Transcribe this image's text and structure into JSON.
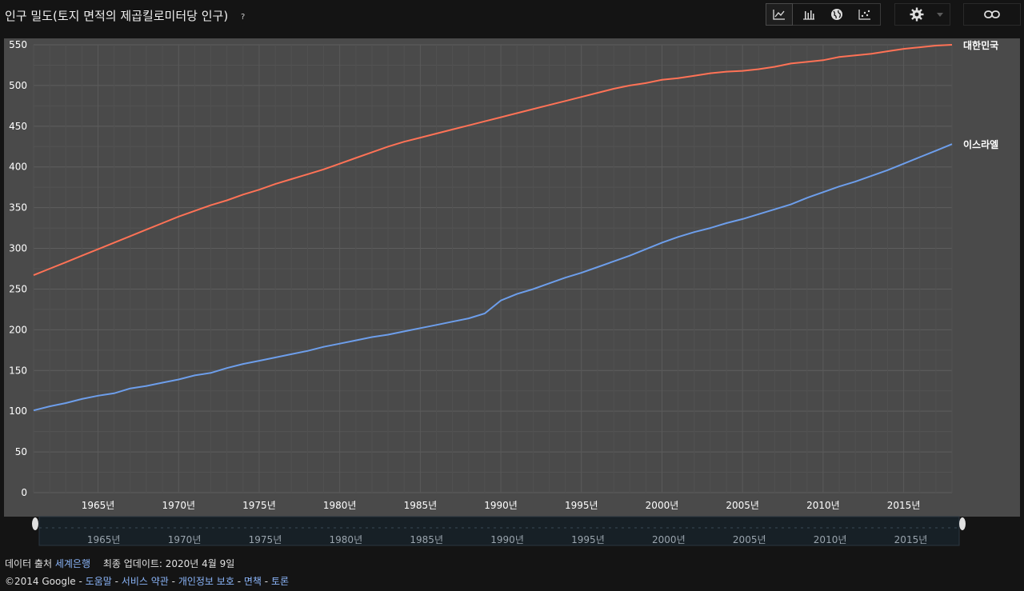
{
  "header": {
    "title": "인구 밀도(토지 면적의 제곱킬로미터당 인구)",
    "help": "?"
  },
  "toolbar": {
    "buttons": [
      "line-chart-icon",
      "bar-chart-icon",
      "globe-icon",
      "scatter-icon"
    ],
    "settings_icon": "gear-icon",
    "dropdown_icon": "caret-down-icon",
    "link_icon": "link-icon"
  },
  "chart_data": {
    "type": "line",
    "title": "",
    "xlabel": "",
    "ylabel": "",
    "xlim": [
      1961,
      2018
    ],
    "ylim": [
      0,
      550
    ],
    "yticks": [
      0,
      50,
      100,
      150,
      200,
      250,
      300,
      350,
      400,
      450,
      500,
      550
    ],
    "xticks": [
      1965,
      1970,
      1975,
      1980,
      1985,
      1990,
      1995,
      2000,
      2005,
      2010,
      2015
    ],
    "xtick_suffix": "년",
    "grid": true,
    "series": [
      {
        "name": "대한민국",
        "color": "#ff7256",
        "x": [
          1961,
          1962,
          1963,
          1964,
          1965,
          1966,
          1967,
          1968,
          1969,
          1970,
          1971,
          1972,
          1973,
          1974,
          1975,
          1976,
          1977,
          1978,
          1979,
          1980,
          1981,
          1982,
          1983,
          1984,
          1985,
          1986,
          1987,
          1988,
          1989,
          1990,
          1991,
          1992,
          1993,
          1994,
          1995,
          1996,
          1997,
          1998,
          1999,
          2000,
          2001,
          2002,
          2003,
          2004,
          2005,
          2006,
          2007,
          2008,
          2009,
          2010,
          2011,
          2012,
          2013,
          2014,
          2015,
          2016,
          2017,
          2018
        ],
        "values": [
          267,
          275,
          283,
          291,
          299,
          307,
          315,
          323,
          331,
          339,
          346,
          353,
          359,
          366,
          372,
          379,
          385,
          391,
          397,
          404,
          411,
          418,
          425,
          431,
          436,
          441,
          446,
          451,
          456,
          461,
          466,
          471,
          476,
          481,
          486,
          491,
          496,
          500,
          503,
          507,
          509,
          512,
          515,
          517,
          518,
          520,
          523,
          527,
          529,
          531,
          535,
          537,
          539,
          542,
          545,
          547,
          549,
          550
        ],
        "end_label": "대한민국"
      },
      {
        "name": "이스라엘",
        "color": "#6d9eeb",
        "x": [
          1961,
          1962,
          1963,
          1964,
          1965,
          1966,
          1967,
          1968,
          1969,
          1970,
          1971,
          1972,
          1973,
          1974,
          1975,
          1976,
          1977,
          1978,
          1979,
          1980,
          1981,
          1982,
          1983,
          1984,
          1985,
          1986,
          1987,
          1988,
          1989,
          1990,
          1991,
          1992,
          1993,
          1994,
          1995,
          1996,
          1997,
          1998,
          1999,
          2000,
          2001,
          2002,
          2003,
          2004,
          2005,
          2006,
          2007,
          2008,
          2009,
          2010,
          2011,
          2012,
          2013,
          2014,
          2015,
          2016,
          2017,
          2018
        ],
        "values": [
          101,
          106,
          110,
          115,
          119,
          122,
          128,
          131,
          135,
          139,
          144,
          147,
          153,
          158,
          162,
          166,
          170,
          174,
          179,
          183,
          187,
          191,
          194,
          198,
          202,
          206,
          210,
          214,
          220,
          236,
          244,
          250,
          257,
          264,
          270,
          277,
          284,
          291,
          299,
          307,
          314,
          320,
          325,
          331,
          336,
          342,
          348,
          354,
          362,
          369,
          376,
          382,
          389,
          396,
          404,
          412,
          420,
          428
        ],
        "end_label": "이스라엘"
      }
    ],
    "legend": "end-of-line labels",
    "navigator_ticks": [
      1965,
      1970,
      1975,
      1980,
      1985,
      1990,
      1995,
      2000,
      2005,
      2010,
      2015
    ]
  },
  "footer": {
    "source_prefix": "데이터 출처",
    "source_link": "세계은행",
    "updated": "최종 업데이트: 2020년 4월 9일",
    "copyright": "©2014 Google",
    "dash": "-",
    "links": [
      "도움말",
      "서비스 약관",
      "개인정보 보호",
      "면책",
      "토론"
    ]
  }
}
